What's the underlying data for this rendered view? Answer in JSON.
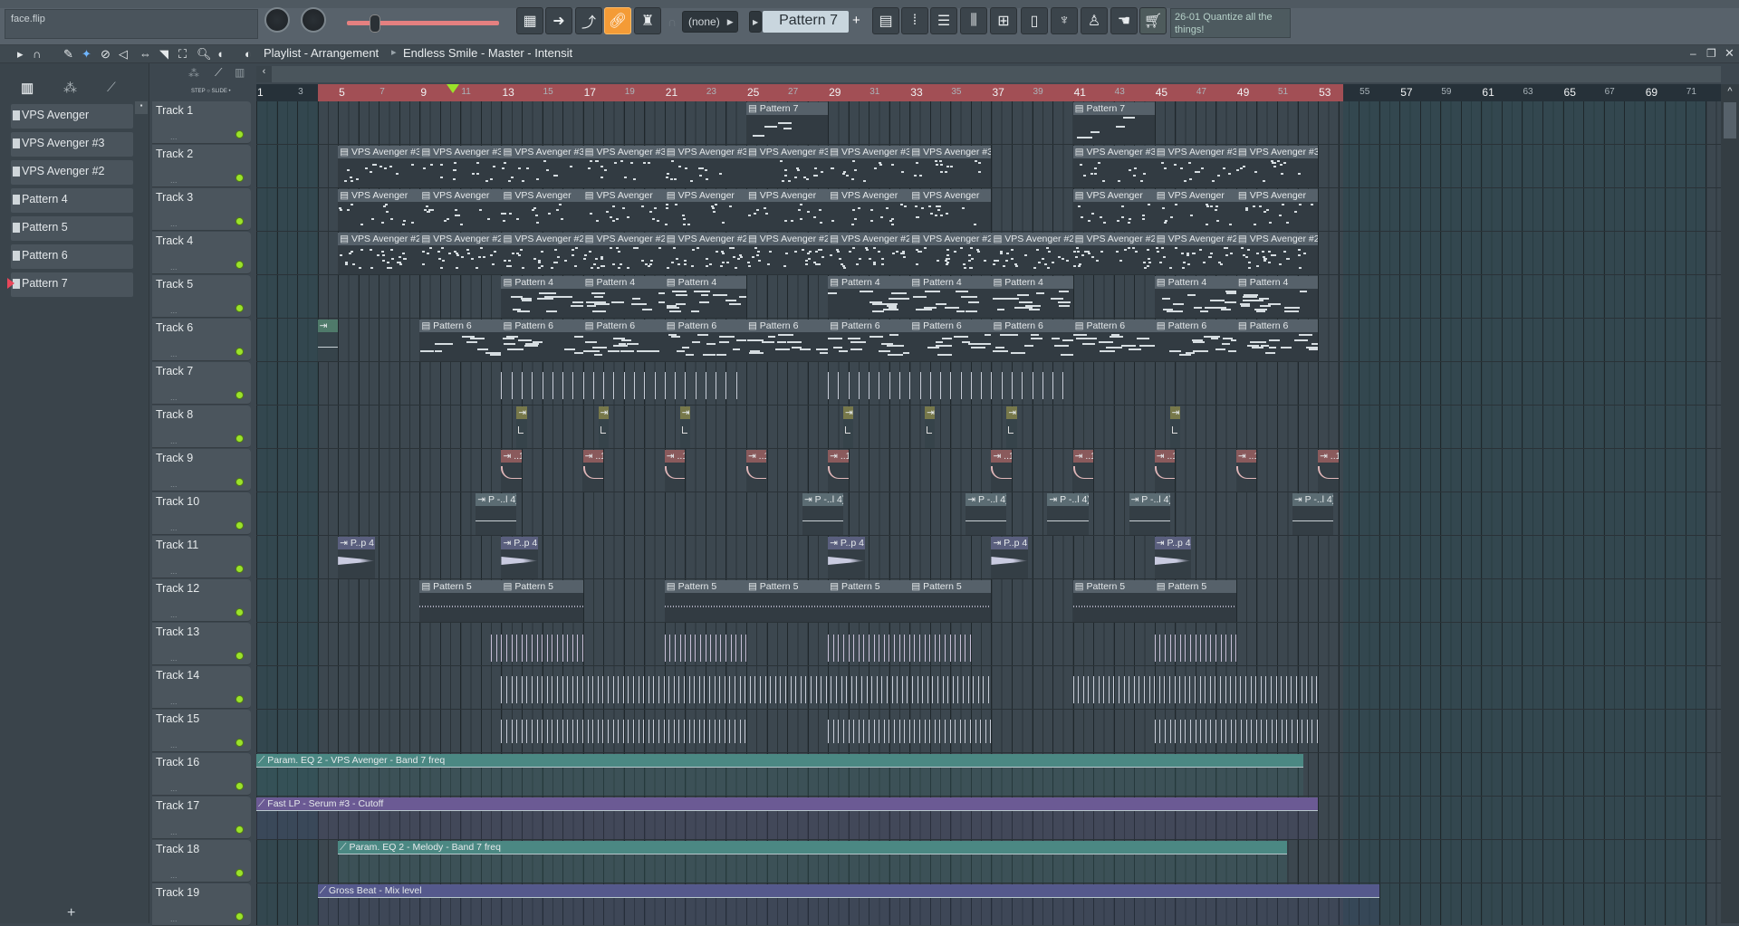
{
  "toolbar": {
    "hint_text": "face.flip",
    "pattern_selector": "Pattern 7",
    "pattern_add": "+",
    "snap_value": "(none)",
    "news_hint": "26-01  Quantize all the things!",
    "buttons": [
      "piano-keys",
      "arrow-right",
      "curve",
      "link",
      "stamp"
    ],
    "tool_icons": [
      "playlist",
      "step-sequencer",
      "channel-rack",
      "mixer",
      "browser",
      "file",
      "plugin",
      "wizard",
      "hand",
      "cart"
    ],
    "active_button": "link"
  },
  "playlist": {
    "title": "Playlist - Arrangement",
    "breadcrumb": "Endless Smile - Master - Intensit",
    "step_label": "STEP",
    "slide_label": "SLIDE",
    "loop_bars": [
      4,
      54.25
    ],
    "playhead_bar": 10.6,
    "ruler_labels": [
      1,
      3,
      5,
      7,
      9,
      11,
      13,
      15,
      17,
      19,
      21,
      23,
      25,
      27,
      29,
      31,
      33,
      35,
      37,
      39,
      41,
      43,
      45,
      47,
      49,
      51,
      53,
      55,
      57,
      59,
      61,
      63,
      65,
      67,
      69,
      71
    ]
  },
  "browser": {
    "items": [
      "VPS Avenger",
      "VPS Avenger #3",
      "VPS Avenger #2",
      "Pattern 4",
      "Pattern 5",
      "Pattern 6",
      "Pattern 7"
    ],
    "selected": "Pattern 7",
    "add_label": "+"
  },
  "colors": {
    "accent": "#f49b36",
    "loop": "#a24f55",
    "led": "#9be22a"
  },
  "tracks": [
    {
      "name": "Track 1",
      "clips": [
        {
          "label": "Pattern 7",
          "start": 25,
          "len": 4,
          "kind": "pattern"
        },
        {
          "label": "Pattern 7",
          "start": 41,
          "len": 4,
          "kind": "pattern"
        }
      ]
    },
    {
      "name": "Track 2",
      "repeat": {
        "label": "VPS Avenger #3",
        "len": 4,
        "kind": "pattern",
        "starts": [
          5,
          9,
          13,
          17,
          21,
          25,
          29,
          33,
          41,
          45,
          49
        ]
      }
    },
    {
      "name": "Track 3",
      "repeat": {
        "label": "VPS Avenger",
        "len": 4,
        "kind": "pattern",
        "starts": [
          5,
          9,
          13,
          17,
          21,
          25,
          29,
          33,
          41,
          45,
          49
        ]
      }
    },
    {
      "name": "Track 4",
      "repeat": {
        "label": "VPS Avenger #2",
        "len": 4,
        "kind": "pattern",
        "starts": [
          5,
          9,
          13,
          17,
          21,
          25,
          29,
          33,
          37,
          41,
          45,
          49
        ]
      }
    },
    {
      "name": "Track 5",
      "repeat": {
        "label": "Pattern 4",
        "len": 4,
        "kind": "pattern",
        "starts": [
          13,
          17,
          21,
          29,
          33,
          37,
          45,
          49
        ]
      }
    },
    {
      "name": "Track 6",
      "clips": [
        {
          "label": "",
          "start": 4,
          "len": 1,
          "kind": "audio6"
        }
      ],
      "repeat": {
        "label": "Pattern 6",
        "len": 4,
        "kind": "pattern",
        "starts": [
          9,
          13,
          17,
          21,
          25,
          29,
          33,
          37,
          41,
          45,
          49
        ]
      }
    },
    {
      "name": "Track 7",
      "clips": [
        {
          "label": "",
          "start": 13,
          "len": 12,
          "kind": "ticks"
        },
        {
          "label": "",
          "start": 29,
          "len": 12,
          "kind": "ticks"
        }
      ]
    },
    {
      "name": "Track 8",
      "repeat": {
        "label": "",
        "len": 0.5,
        "kind": "audio8",
        "starts": [
          13.75,
          17.75,
          21.75,
          29.75,
          33.75,
          37.75,
          45.75
        ]
      }
    },
    {
      "name": "Track 9",
      "repeat": {
        "label": "..1",
        "len": 1,
        "kind": "audio9",
        "starts": [
          13,
          17,
          21,
          25,
          29,
          37,
          41,
          45,
          49,
          53
        ]
      }
    },
    {
      "name": "Track 10",
      "repeat": {
        "label": "P -..l 4)",
        "len": 2,
        "kind": "audio10",
        "starts": [
          11.75,
          27.75,
          35.75,
          39.75,
          43.75,
          51.75
        ]
      }
    },
    {
      "name": "Track 11",
      "repeat": {
        "label": "P..p 4",
        "len": 1.8,
        "kind": "audio11",
        "starts": [
          5,
          13,
          29,
          37,
          45
        ]
      }
    },
    {
      "name": "Track 12",
      "repeat": {
        "label": "Pattern 5",
        "len": 4,
        "kind": "pattern5",
        "starts": [
          9,
          13,
          21,
          25,
          29,
          33,
          41,
          45
        ]
      }
    },
    {
      "name": "Track 13",
      "clips": [
        {
          "label": "",
          "start": 12.5,
          "len": 4.5,
          "kind": "ticks"
        },
        {
          "label": "",
          "start": 21,
          "len": 4,
          "kind": "ticks"
        },
        {
          "label": "",
          "start": 29,
          "len": 7,
          "kind": "ticks"
        },
        {
          "label": "",
          "start": 45,
          "len": 4,
          "kind": "ticks"
        }
      ]
    },
    {
      "name": "Track 14",
      "clips": [
        {
          "label": "",
          "start": 13,
          "len": 24,
          "kind": "ticks"
        },
        {
          "label": "",
          "start": 41,
          "len": 12,
          "kind": "ticks"
        }
      ]
    },
    {
      "name": "Track 15",
      "clips": [
        {
          "label": "",
          "start": 13,
          "len": 12,
          "kind": "ticks"
        },
        {
          "label": "",
          "start": 29,
          "len": 8,
          "kind": "ticks"
        },
        {
          "label": "",
          "start": 45,
          "len": 8,
          "kind": "ticks"
        }
      ]
    },
    {
      "name": "Track 16",
      "clips": [
        {
          "label": "Param. EQ 2 - VPS Avenger - Band 7 freq",
          "start": 1,
          "len": 51.3,
          "kind": "auto-teal"
        }
      ]
    },
    {
      "name": "Track 17",
      "clips": [
        {
          "label": "Fast LP - Serum #3 - Cutoff",
          "start": 1,
          "len": 52,
          "kind": "auto-purple"
        }
      ]
    },
    {
      "name": "Track 18",
      "clips": [
        {
          "label": "Param. EQ 2 - Melody - Band 7 freq",
          "start": 5,
          "len": 46.5,
          "kind": "auto-teal"
        }
      ]
    },
    {
      "name": "Track 19",
      "clips": [
        {
          "label": "Gross Beat - Mix level",
          "start": 4,
          "len": 52,
          "kind": "auto-blue"
        }
      ]
    }
  ]
}
